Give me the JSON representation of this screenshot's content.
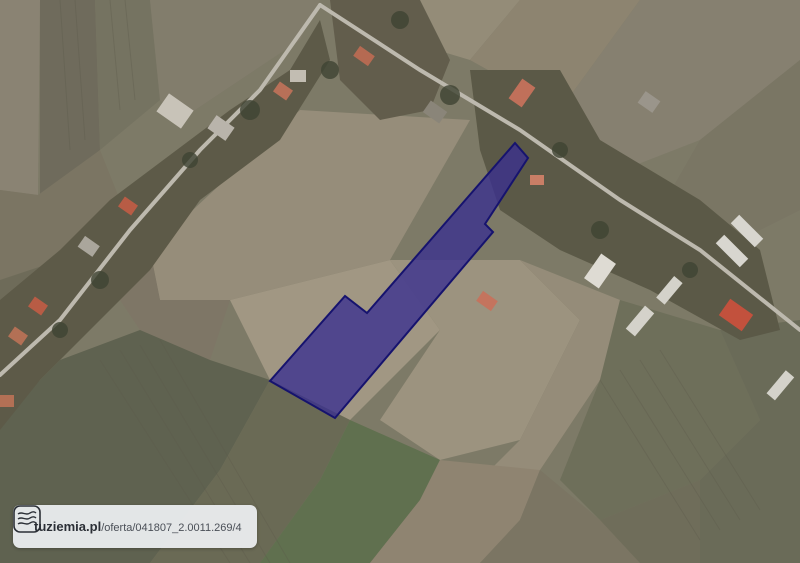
{
  "map": {
    "type": "satellite-parcel-view",
    "parcel_outline_color": "#1c1a7a",
    "parcel_fill_color": "#3a2f8f"
  },
  "badge": {
    "site": "tuziemia.pl",
    "reference": "/oferta/041807_2.0011.269/4",
    "logo_icon": "topographic-contour-logo"
  }
}
